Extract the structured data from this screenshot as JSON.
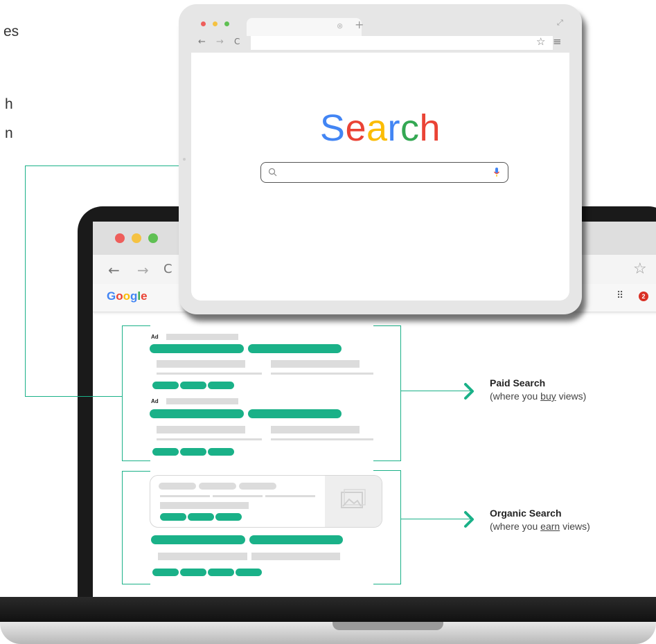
{
  "left_text": {
    "line1": "es",
    "line2": "h",
    "line3": "n"
  },
  "floating_browser": {
    "search_title_letters": [
      {
        "char": "S",
        "color": "#4285f4"
      },
      {
        "char": "e",
        "color": "#ea4335"
      },
      {
        "char": "a",
        "color": "#fbbc05"
      },
      {
        "char": "r",
        "color": "#4285f4"
      },
      {
        "char": "c",
        "color": "#34a853"
      },
      {
        "char": "h",
        "color": "#ea4335"
      }
    ],
    "icons": [
      "back-arrow-icon",
      "forward-arrow-icon",
      "reload-icon",
      "star-icon",
      "menu-icon",
      "plus-icon",
      "close-tab-icon",
      "expand-icon",
      "search-icon",
      "microphone-icon"
    ]
  },
  "laptop_browser": {
    "logo_letters": [
      {
        "char": "G",
        "color": "#4285f4"
      },
      {
        "char": "o",
        "color": "#ea4335"
      },
      {
        "char": "o",
        "color": "#fbbc05"
      },
      {
        "char": "g",
        "color": "#4285f4"
      },
      {
        "char": "l",
        "color": "#34a853"
      },
      {
        "char": "e",
        "color": "#ea4335"
      }
    ],
    "notification_count": "2",
    "ad_labels": [
      "Ad",
      "Ad"
    ]
  },
  "labels": {
    "paid": {
      "title": "Paid Search",
      "sub_before": "(where you ",
      "sub_emph": "buy",
      "sub_after": " views)"
    },
    "organic": {
      "title": "Organic Search",
      "sub_before": "(where you ",
      "sub_emph": "earn",
      "sub_after": " views)"
    }
  },
  "colors": {
    "accent_green": "#1ab188",
    "placeholder_gray": "#dcdcdc"
  }
}
